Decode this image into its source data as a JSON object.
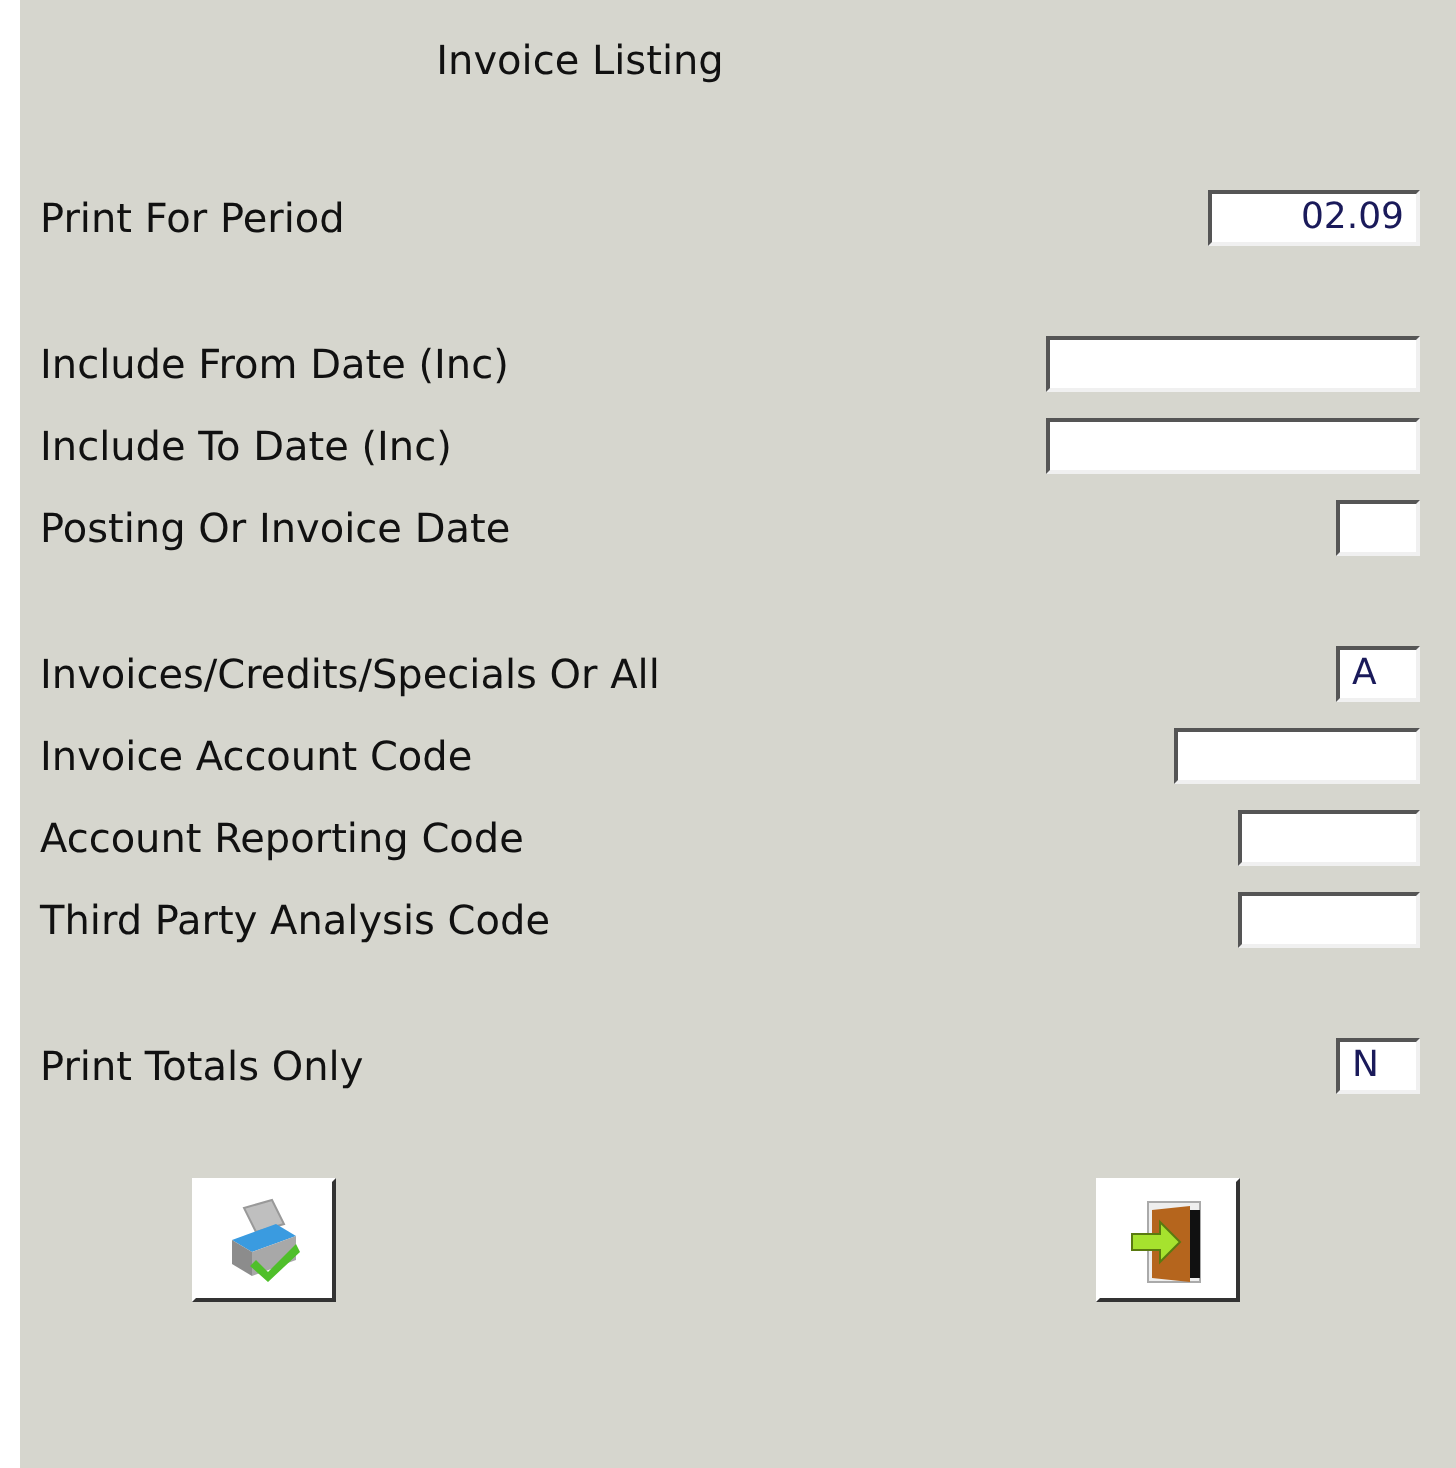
{
  "title": "Invoice Listing",
  "groups": [
    [
      {
        "label": "Print For Period",
        "value": "02.09"
      }
    ],
    [
      {
        "label": "Include From Date (Inc)"
      },
      {
        "label": "Include To Date (Inc)"
      },
      {
        "label": "Posting Or Invoice Date"
      }
    ],
    [
      {
        "label": "Invoices/Credits/Specials Or All",
        "value": "A"
      },
      {
        "label": "Invoice Account Code"
      },
      {
        "label": "Account Reporting Code"
      },
      {
        "label": "Third Party Analysis Code"
      }
    ],
    [
      {
        "label": "Print Totals Only",
        "value": "N"
      }
    ]
  ]
}
